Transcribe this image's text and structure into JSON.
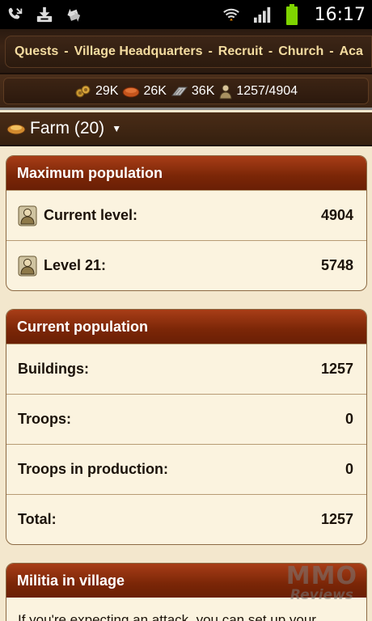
{
  "status_bar": {
    "time": "16:17",
    "icons": [
      "missed-call-icon",
      "download-icon",
      "sync-icon",
      "wifi-icon",
      "signal-icon",
      "battery-icon"
    ]
  },
  "nav": {
    "items": [
      "Quests",
      "Village Headquarters",
      "Recruit",
      "Church",
      "Aca"
    ],
    "separator": "-"
  },
  "resources": {
    "wood": "29K",
    "clay": "26K",
    "iron": "36K",
    "population": "1257/4904"
  },
  "building": {
    "title": "Farm (20)",
    "caret": "▼"
  },
  "max_population": {
    "header": "Maximum population",
    "rows": [
      {
        "label": "Current level:",
        "value": "4904"
      },
      {
        "label": "Level 21:",
        "value": "5748"
      }
    ]
  },
  "current_population": {
    "header": "Current population",
    "rows": [
      {
        "label": "Buildings:",
        "value": "1257"
      },
      {
        "label": "Troops:",
        "value": "0"
      },
      {
        "label": "Troops in production:",
        "value": "0"
      },
      {
        "label": "Total:",
        "value": "1257"
      }
    ]
  },
  "militia": {
    "header": "Militia in village",
    "text": "If you're expecting an attack, you can set up your"
  },
  "watermark": {
    "top": "MMO",
    "bottom": "Reviews"
  },
  "colors": {
    "panel_header": "#7a2607",
    "nav_text": "#f4dca0",
    "background": "#f3e7cd"
  }
}
